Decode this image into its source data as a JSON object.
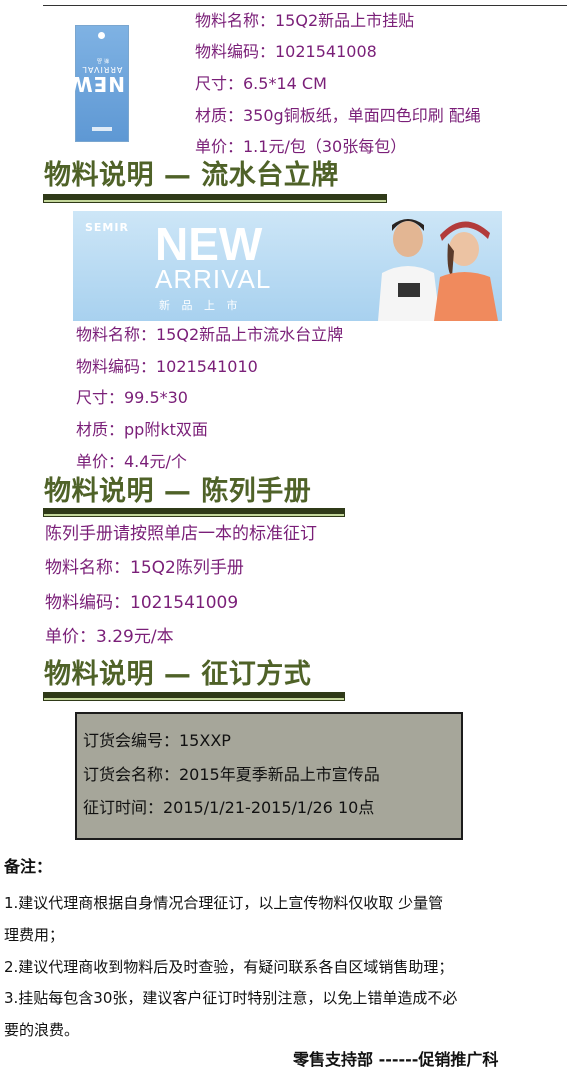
{
  "item1": {
    "hangtag": {
      "title": "NEW",
      "subtitle": "ARRIVAL",
      "tagline": "新品"
    },
    "name": "物料名称：15Q2新品上市挂贴",
    "code": "物料编码：1021541008",
    "size": "尺寸：6.5*14 CM",
    "material": "材质：350g铜板纸，单面四色印刷 配绳",
    "price": "单价：1.1元/包（30张每包）"
  },
  "section2": {
    "title": "物料说明 —  流水台立牌",
    "banner": {
      "brand": "SEMIR",
      "headline": "NEW",
      "subline": "ARRIVAL",
      "cn_text": "新 品 上 市"
    },
    "name": "物料名称：15Q2新品上市流水台立牌",
    "code": "物料编码：1021541010",
    "size": "尺寸：99.5*30",
    "material": "材质：pp附kt双面",
    "price": "单价：4.4元/个"
  },
  "section3": {
    "title": "物料说明 — 陈列手册",
    "instruction": "陈列手册请按照单店一本的标准征订",
    "name": "物料名称：15Q2陈列手册",
    "code": "物料编码：1021541009",
    "price": "单价：3.29元/本"
  },
  "section4": {
    "title": "物料说明 — 征订方式",
    "order_code": "订货会编号：15XXP",
    "order_name": "订货会名称：2015年夏季新品上市宣传品",
    "order_time": "征订时间：2015/1/21-2015/1/26    10点"
  },
  "notes": {
    "heading": "备注：",
    "line1a": "1.建议代理商根据自身情况合理征订，以上宣传物料仅收取  少量管",
    "line1b": "理费用；",
    "line2": "2.建议代理商收到物料后及时查验，有疑问联系各自区域销售助理；",
    "line3a": "3.挂贴每包含30张，建议客户征订时特别注意，以免上错单造成不必",
    "line3b": "要的浪费。"
  },
  "signature": "零售支持部  ------促销推广科",
  "colors": {
    "title_green": "#4f6228",
    "spec_purple": "#7a1f78",
    "box_gray": "#a6a69a"
  }
}
